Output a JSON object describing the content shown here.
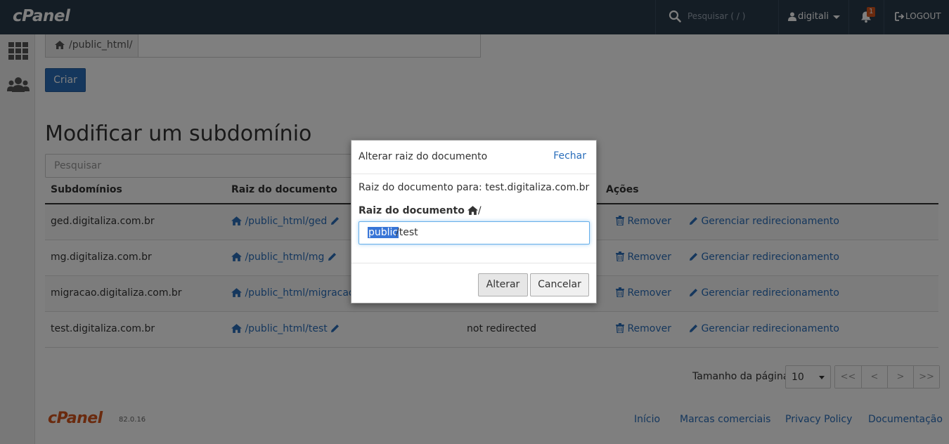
{
  "topbar": {
    "logo": "cPanel",
    "search_placeholder": "Pesquisar ( / )",
    "username": "digitali",
    "notification_count": "1",
    "logout_label": "LOGOUT"
  },
  "sidebar": {
    "items": [
      {
        "icon": "apps-grid-icon"
      },
      {
        "icon": "users-icon"
      }
    ]
  },
  "create_form": {
    "path_prefix": "/public_html/",
    "create_button": "Criar"
  },
  "modify_section": {
    "title": "Modificar um subdomínio",
    "search_placeholder": "Pesquisar",
    "columns": {
      "subdomain": "Subdomínios",
      "doc_root": "Raiz do documento",
      "actions": "Ações"
    },
    "rows": [
      {
        "subdomain": "ged.digitaliza.com.br",
        "doc_root": "/public_html/ged",
        "redirect": "",
        "remove": "Remover",
        "manage": "Gerenciar redirecionamento"
      },
      {
        "subdomain": "mg.digitaliza.com.br",
        "doc_root": "/public_html/mg",
        "redirect": "",
        "remove": "Remover",
        "manage": "Gerenciar redirecionamento"
      },
      {
        "subdomain": "migracao.digitaliza.com.br",
        "doc_root": "/public_html/migracao",
        "redirect": "",
        "remove": "Remover",
        "manage": "Gerenciar redirecionamento"
      },
      {
        "subdomain": "test.digitaliza.com.br",
        "doc_root": "/public_html/test",
        "redirect": "not redirected",
        "remove": "Remover",
        "manage": "Gerenciar redirecionamento"
      }
    ],
    "pager": {
      "page_size_label": "Tamanho da página",
      "page_size": "10",
      "first": "<<",
      "prev": "<",
      "next": ">",
      "last": ">>"
    }
  },
  "footer": {
    "logo": "cPanel",
    "version": "82.0.16",
    "links": [
      "Início",
      "Marcas comerciais",
      "Privacy Policy",
      "Documentação"
    ]
  },
  "modal": {
    "title": "Alterar raiz do documento",
    "close_label": "Fechar",
    "description": "Raiz do documento para: test.digitaliza.com.br",
    "field_label": "Raiz do documento",
    "field_suffix": "/",
    "input_selected": "public",
    "input_rest": "/test",
    "submit_label": "Alterar",
    "cancel_label": "Cancelar"
  },
  "colors": {
    "topbar": "#293a4a",
    "link": "#2a6ebb",
    "primary": "#2a6ebb",
    "brand_orange": "#d4541c"
  }
}
